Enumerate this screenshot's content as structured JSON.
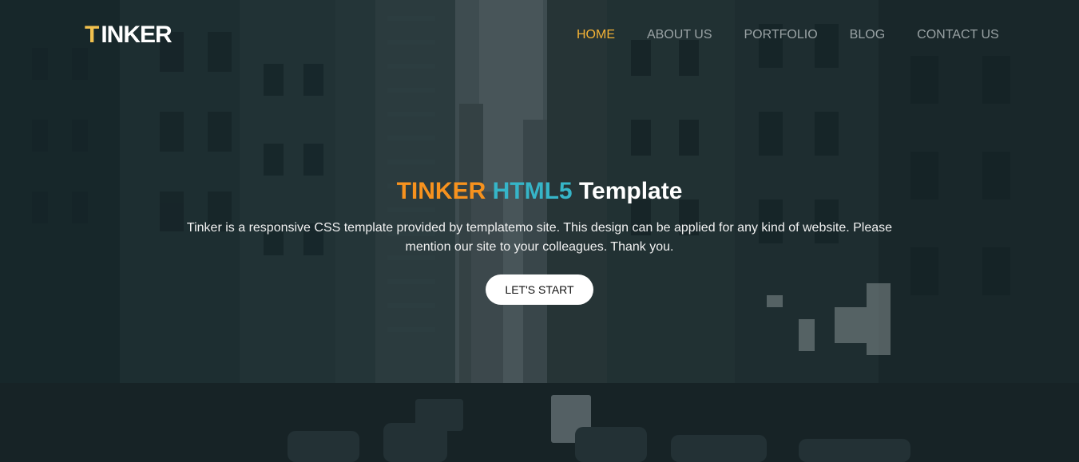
{
  "brand": {
    "logo_first": "T",
    "logo_rest": "INKER",
    "accent_color": "#f2c14e"
  },
  "nav": {
    "items": [
      {
        "label": "HOME",
        "active": true
      },
      {
        "label": "ABOUT US",
        "active": false
      },
      {
        "label": "PORTFOLIO",
        "active": false
      },
      {
        "label": "BLOG",
        "active": false
      },
      {
        "label": "CONTACT US",
        "active": false
      }
    ],
    "active_color": "#f5b335",
    "text_color": "#9aa3a5"
  },
  "hero": {
    "title_word1": "TINKER",
    "title_word2": "HTML5",
    "title_word3": "Template",
    "title_colors": [
      "#f7921e",
      "#36b5c8",
      "#ffffff"
    ],
    "description": "Tinker is a responsive CSS template provided by templatemo site. This design can be applied for any kind of website. Please mention our site to your colleagues. Thank you.",
    "cta_label": "LET'S START"
  }
}
